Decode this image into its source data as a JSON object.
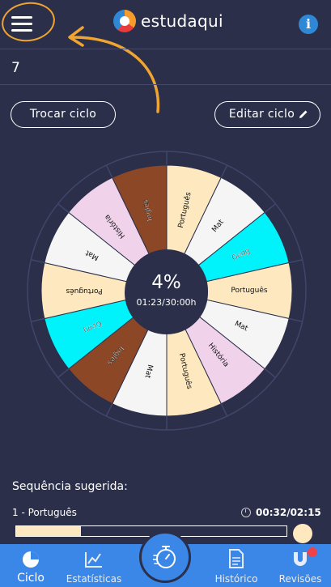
{
  "app": {
    "name": "estudaqui"
  },
  "cycle": {
    "number": "7",
    "progress_percent": "4%",
    "time": "01:23/30:00h"
  },
  "buttons": {
    "trocar": "Trocar ciclo",
    "editar": "Editar ciclo"
  },
  "wheel_segments": [
    {
      "label": "Português",
      "color": "#fde8bf"
    },
    {
      "label": "Mat",
      "color": "#f5f5f5"
    },
    {
      "label": "Geog",
      "color": "#00f2fb"
    },
    {
      "label": "Português",
      "color": "#fde8bf"
    },
    {
      "label": "Mat",
      "color": "#f5f5f5"
    },
    {
      "label": "História",
      "color": "#f0d2ea"
    },
    {
      "label": "Português",
      "color": "#fde8bf"
    },
    {
      "label": "Mat",
      "color": "#f5f5f5"
    },
    {
      "label": "Inglês",
      "color": "#8b4726"
    },
    {
      "label": "Geog",
      "color": "#00f2fb"
    },
    {
      "label": "Português",
      "color": "#fde8bf"
    },
    {
      "label": "Mat",
      "color": "#f5f5f5"
    },
    {
      "label": "História",
      "color": "#f0d2ea"
    },
    {
      "label": "Inglês",
      "color": "#8b4726"
    }
  ],
  "sequence": {
    "title": "Sequência sugerida:",
    "item": "1 - Português",
    "time": "00:32/02:15",
    "progress_fraction": 0.24
  },
  "nav": {
    "ciclo": "Ciclo",
    "estatisticas": "Estatísticas",
    "historico": "Histórico",
    "revisoes": "Revisões"
  },
  "colors": {
    "background": "#2b2f4a",
    "nav": "#3a87e8",
    "accent": "#f0a531"
  }
}
